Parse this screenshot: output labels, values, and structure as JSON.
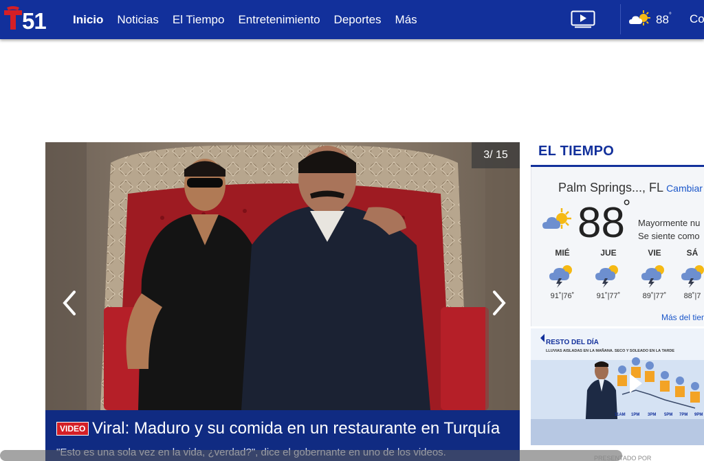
{
  "brand": {
    "logo_text": "T51",
    "colors": {
      "nav_bg": "#12309b",
      "accent": "#d51f26",
      "caption_bg": "#102b82"
    }
  },
  "nav": {
    "items": [
      {
        "label": "Inicio",
        "active": true
      },
      {
        "label": "Noticias"
      },
      {
        "label": "El Tiempo"
      },
      {
        "label": "Entretenimiento"
      },
      {
        "label": "Deportes"
      },
      {
        "label": "Más"
      }
    ],
    "overflow_label": "Co"
  },
  "header_weather": {
    "temp": "88",
    "deg": "°",
    "icon": "partly-sunny-icon"
  },
  "slideshow": {
    "counter": "3/ 15",
    "badge": "VIDEO",
    "headline": "Viral: Maduro y su comida en un restaurante en Turquía",
    "subline": "\"Esto es una sola vez en la vida, ¿verdad?\", dice el gobernante en uno de los videos."
  },
  "weather": {
    "section_title": "EL TIEMPO",
    "location": "Palm Springs..., FL",
    "change_label": "Cambiar",
    "current_temp": "88",
    "deg": "°",
    "condition_line1": "Mayormente nu",
    "condition_line2": "Se siente como",
    "forecast": [
      {
        "day": "MIÉ",
        "hl": "91˚|76˚",
        "icon": "thunderstorm-icon"
      },
      {
        "day": "JUE",
        "hl": "91˚|77˚",
        "icon": "thunderstorm-icon"
      },
      {
        "day": "VIE",
        "hl": "89˚|77˚",
        "icon": "thunderstorm-icon"
      },
      {
        "day": "SÁ",
        "hl": "88˚|7",
        "icon": "thunderstorm-icon"
      }
    ],
    "more_link": "Más del tiem"
  },
  "weather_video": {
    "banner": "RESTO DEL DÍA",
    "subbanner": "LLUVIAS AISLADAS EN LA MAÑANA. SECO Y SOLEADO EN LA TARDE",
    "times": [
      "11AM",
      "1PM",
      "3PM",
      "5PM",
      "7PM",
      "9PM"
    ],
    "sponsor": "PRESENTADO POR"
  }
}
